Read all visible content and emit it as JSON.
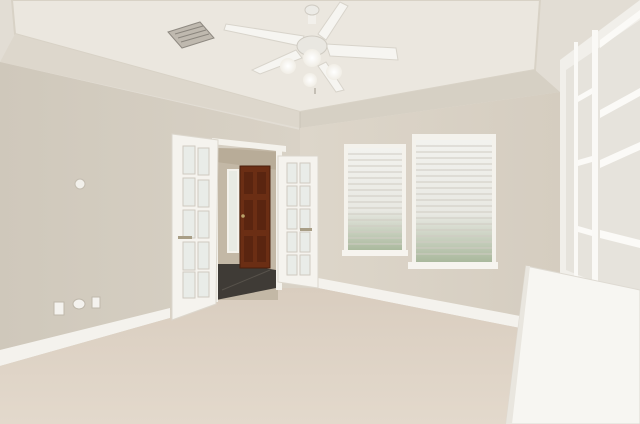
{
  "scene": {
    "room": "empty bedroom",
    "elements": [
      "tray-ceiling",
      "ceiling-fan",
      "hvac-vent",
      "french-doors",
      "front-door",
      "windows-with-blinds",
      "built-in-shelves",
      "carpet",
      "thermostat",
      "outlets"
    ]
  },
  "colors": {
    "wall": "#d8d1c5",
    "wall_shadow": "#c9c1b3",
    "ceiling": "#e6e2da",
    "trim": "#f6f4ef",
    "carpet": "#ddd1c3",
    "door_wood": "#6b2e14",
    "tile": "#3d3a36"
  }
}
